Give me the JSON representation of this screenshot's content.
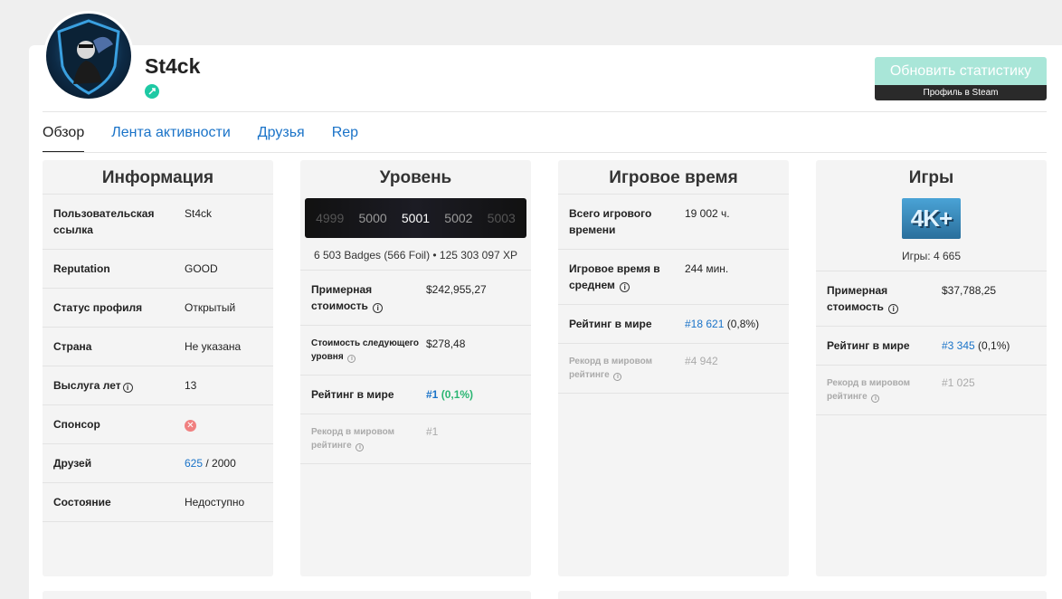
{
  "profile": {
    "username": "St4ck",
    "refresh_button": "Обновить статистику",
    "steam_profile_link": "Профиль в Steam"
  },
  "tabs": [
    {
      "label": "Обзор",
      "active": true
    },
    {
      "label": "Лента активности"
    },
    {
      "label": "Друзья"
    },
    {
      "label": "Rep"
    }
  ],
  "info": {
    "title": "Информация",
    "rows": {
      "link": {
        "label": "Пользовательская ссылка",
        "value": "St4ck"
      },
      "reputation": {
        "label": "Reputation",
        "value": "GOOD"
      },
      "status": {
        "label": "Статус профиля",
        "value": "Открытый"
      },
      "country": {
        "label": "Страна",
        "value": "Не указана"
      },
      "years": {
        "label": "Выслуга лет",
        "value": "13"
      },
      "sponsor": {
        "label": "Спонсор"
      },
      "friends": {
        "label": "Друзей",
        "count": "625",
        "limit": "/ 2000"
      },
      "state": {
        "label": "Состояние",
        "value": "Недоступно"
      }
    }
  },
  "level": {
    "title": "Уровень",
    "levels": [
      "4999",
      "5000",
      "5001",
      "5002",
      "5003"
    ],
    "current": "5001",
    "summary": "6 503 Badges (566 Foil) • 125 303 097 XP",
    "value_label": "Примерная стоимость",
    "value": "$242,955,27",
    "next_label": "Стоимость следующего уровня",
    "next_value": "$278,48",
    "rank_label": "Рейтинг в мире",
    "rank_value": "#1",
    "rank_pct": "(0,1%)",
    "record_label": "Рекорд в мировом рейтинге",
    "record_value": "#1"
  },
  "playtime": {
    "title": "Игровое время",
    "total_label": "Всего игрового времени",
    "total_value": "19 002 ч.",
    "avg_label": "Игровое время в среднем",
    "avg_value": "244 мин.",
    "rank_label": "Рейтинг в мире",
    "rank_value": "#18 621",
    "rank_pct": "(0,8%)",
    "record_label": "Рекорд в мировом рейтинге",
    "record_value": "#4 942"
  },
  "games": {
    "title": "Игры",
    "badge_text": "4K+",
    "count_text": "Игры: 4 665",
    "value_label": "Примерная стоимость",
    "value": "$37,788,25",
    "rank_label": "Рейтинг в мире",
    "rank_value": "#3 345",
    "rank_pct": "(0,1%)",
    "record_label": "Рекорд в мировом рейтинге",
    "record_value": "#1 025"
  },
  "colors": {
    "accent": "#1a73c8",
    "good": "#2bd36e",
    "refresh_button": "#a9e6d8",
    "online": "#1ec9a4"
  }
}
